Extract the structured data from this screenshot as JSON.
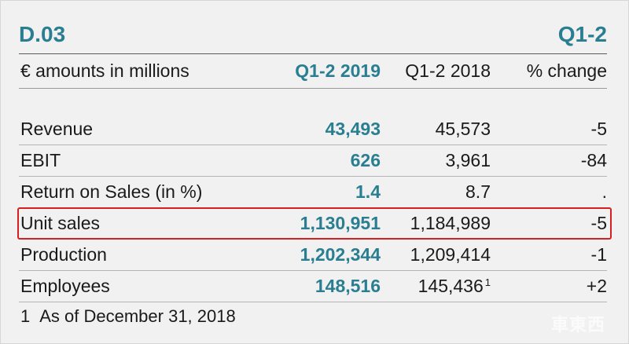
{
  "table": {
    "id": "D.03",
    "period": "Q1-2",
    "header": {
      "label": "€ amounts in millions",
      "col_2019": "Q1-2 2019",
      "col_2018": "Q1-2 2018",
      "col_change": "% change"
    },
    "rows": [
      {
        "label": "Revenue",
        "v2019": "43,493",
        "v2018": "45,573",
        "change": "-5"
      },
      {
        "label": "EBIT",
        "v2019": "626",
        "v2018": "3,961",
        "change": "-84"
      },
      {
        "label": "Return on Sales (in %)",
        "v2019": "1.4",
        "v2018": "8.7",
        "change": "."
      },
      {
        "label": "Unit sales",
        "v2019": "1,130,951",
        "v2018": "1,184,989",
        "change": "-5"
      },
      {
        "label": "Production",
        "v2019": "1,202,344",
        "v2018": "1,209,414",
        "change": "-1"
      },
      {
        "label": "Employees",
        "v2019": "148,516",
        "v2018": "145,436",
        "v2018_note": "1",
        "change": "+2"
      }
    ],
    "footnote": {
      "number": "1",
      "text": "As of December 31, 2018"
    }
  },
  "highlighted_row": "Unit sales",
  "colors": {
    "accent": "#2a7e92",
    "highlight": "#d42020"
  },
  "watermark": "車東西"
}
